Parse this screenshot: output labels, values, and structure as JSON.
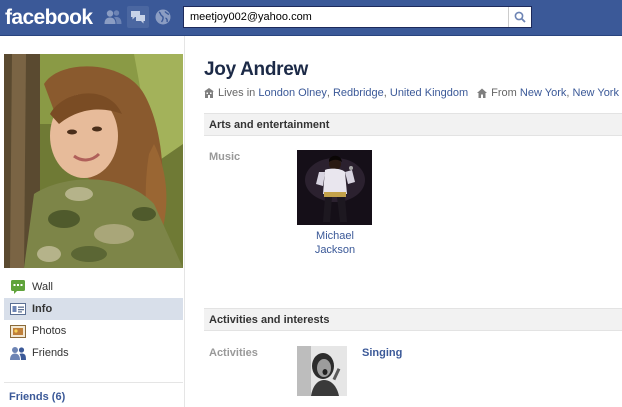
{
  "header": {
    "logo": "facebook",
    "search_value": "meetjoy002@yahoo.com",
    "colors": {
      "bar": "#3b5998",
      "link": "#3b5998"
    }
  },
  "sidebar": {
    "items": [
      {
        "label": "Wall",
        "icon": "wall-icon"
      },
      {
        "label": "Info",
        "icon": "info-icon",
        "selected": true
      },
      {
        "label": "Photos",
        "icon": "photos-icon"
      },
      {
        "label": "Friends",
        "icon": "friends-icon"
      }
    ],
    "friends_link": "Friends (6)"
  },
  "profile": {
    "name": "Joy Andrew",
    "lives_prefix": "Lives in",
    "lives_city": "London Olney",
    "lives_sep1": ",",
    "lives_region": "Redbridge",
    "lives_sep2": ",",
    "lives_country": "United Kingdom",
    "from_prefix": "From",
    "from_city": "New York",
    "from_sep": ",",
    "from_region": "New York"
  },
  "sections": [
    {
      "title": "Arts and entertainment",
      "rows": [
        {
          "label": "Music",
          "items": [
            {
              "line1": "Michael",
              "line2": "Jackson"
            }
          ]
        }
      ]
    },
    {
      "title": "Activities and interests",
      "rows": [
        {
          "label": "Activities",
          "items": [
            {
              "name": "Singing"
            }
          ]
        }
      ]
    }
  ]
}
